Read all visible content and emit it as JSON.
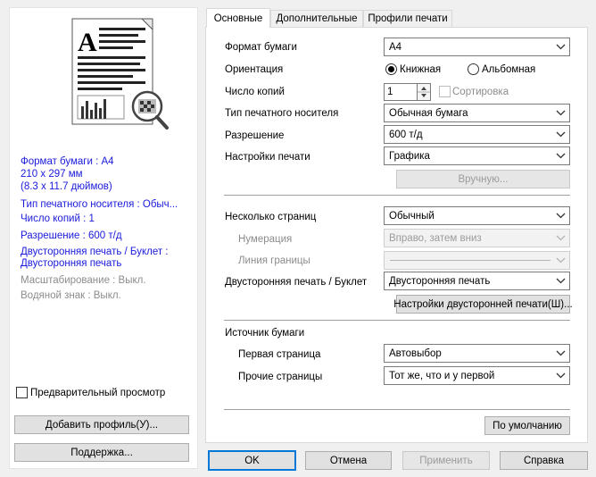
{
  "preview_panel": {
    "info": [
      {
        "text": "Формат бумаги : A4",
        "style": "blue"
      },
      {
        "text": "210 x 297 мм",
        "style": "blue"
      },
      {
        "text": "(8.3 x 11.7 дюймов)",
        "style": "blue"
      },
      {
        "text": "Тип печатного носителя : Обыч...",
        "style": "blue"
      },
      {
        "text": "Число копий : 1",
        "style": "blue"
      },
      {
        "text": "Разрешение : 600 т/д",
        "style": "blue"
      },
      {
        "text": "Двусторонняя печать / Буклет :",
        "style": "blue"
      },
      {
        "text": "Двусторонняя печать",
        "style": "blue"
      },
      {
        "text": "Масштабирование : Выкл.",
        "style": "gray"
      },
      {
        "text": "Водяной знак : Выкл.",
        "style": "gray"
      }
    ],
    "preview_checkbox_label": "Предварительный просмотр",
    "add_profile_label": "Добавить профиль(У)...",
    "support_label": "Поддержка..."
  },
  "tabs": [
    "Основные",
    "Дополнительные",
    "Профили печати"
  ],
  "basic": {
    "paper_size": {
      "label": "Формат бумаги",
      "value": "A4"
    },
    "orientation": {
      "label": "Ориентация",
      "portrait": "Книжная",
      "landscape": "Альбомная",
      "selected": "portrait"
    },
    "copies": {
      "label": "Число копий",
      "value": "1",
      "collate_label": "Сортировка"
    },
    "media_type": {
      "label": "Тип печатного носителя",
      "value": "Обычная бумага"
    },
    "resolution": {
      "label": "Разрешение",
      "value": "600 т/д"
    },
    "print_settings": {
      "label": "Настройки печати",
      "value": "Графика"
    },
    "manual_label": "Вручную...",
    "multiple_pages": {
      "label": "Несколько страниц",
      "value": "Обычный"
    },
    "page_order": {
      "label": "Нумерация",
      "value": "Вправо, затем вниз"
    },
    "border_line": {
      "label": "Линия границы",
      "value": ""
    },
    "duplex": {
      "label": "Двусторонняя печать / Буклет",
      "value": "Двусторонняя печать"
    },
    "duplex_settings_label": "Настройки двусторонней печати(Ш)...",
    "paper_source": {
      "label": "Источник бумаги",
      "first_page": {
        "label": "Первая страница",
        "value": "Автовыбор"
      },
      "other_pages": {
        "label": "Прочие страницы",
        "value": "Тот же, что и у первой"
      }
    },
    "default_label": "По умолчанию"
  },
  "footer": {
    "ok": "OK",
    "cancel": "Отмена",
    "apply": "Применить",
    "help": "Справка"
  },
  "colors": {
    "info_blue": "#1a1adc",
    "focus_blue": "#0078d7"
  }
}
